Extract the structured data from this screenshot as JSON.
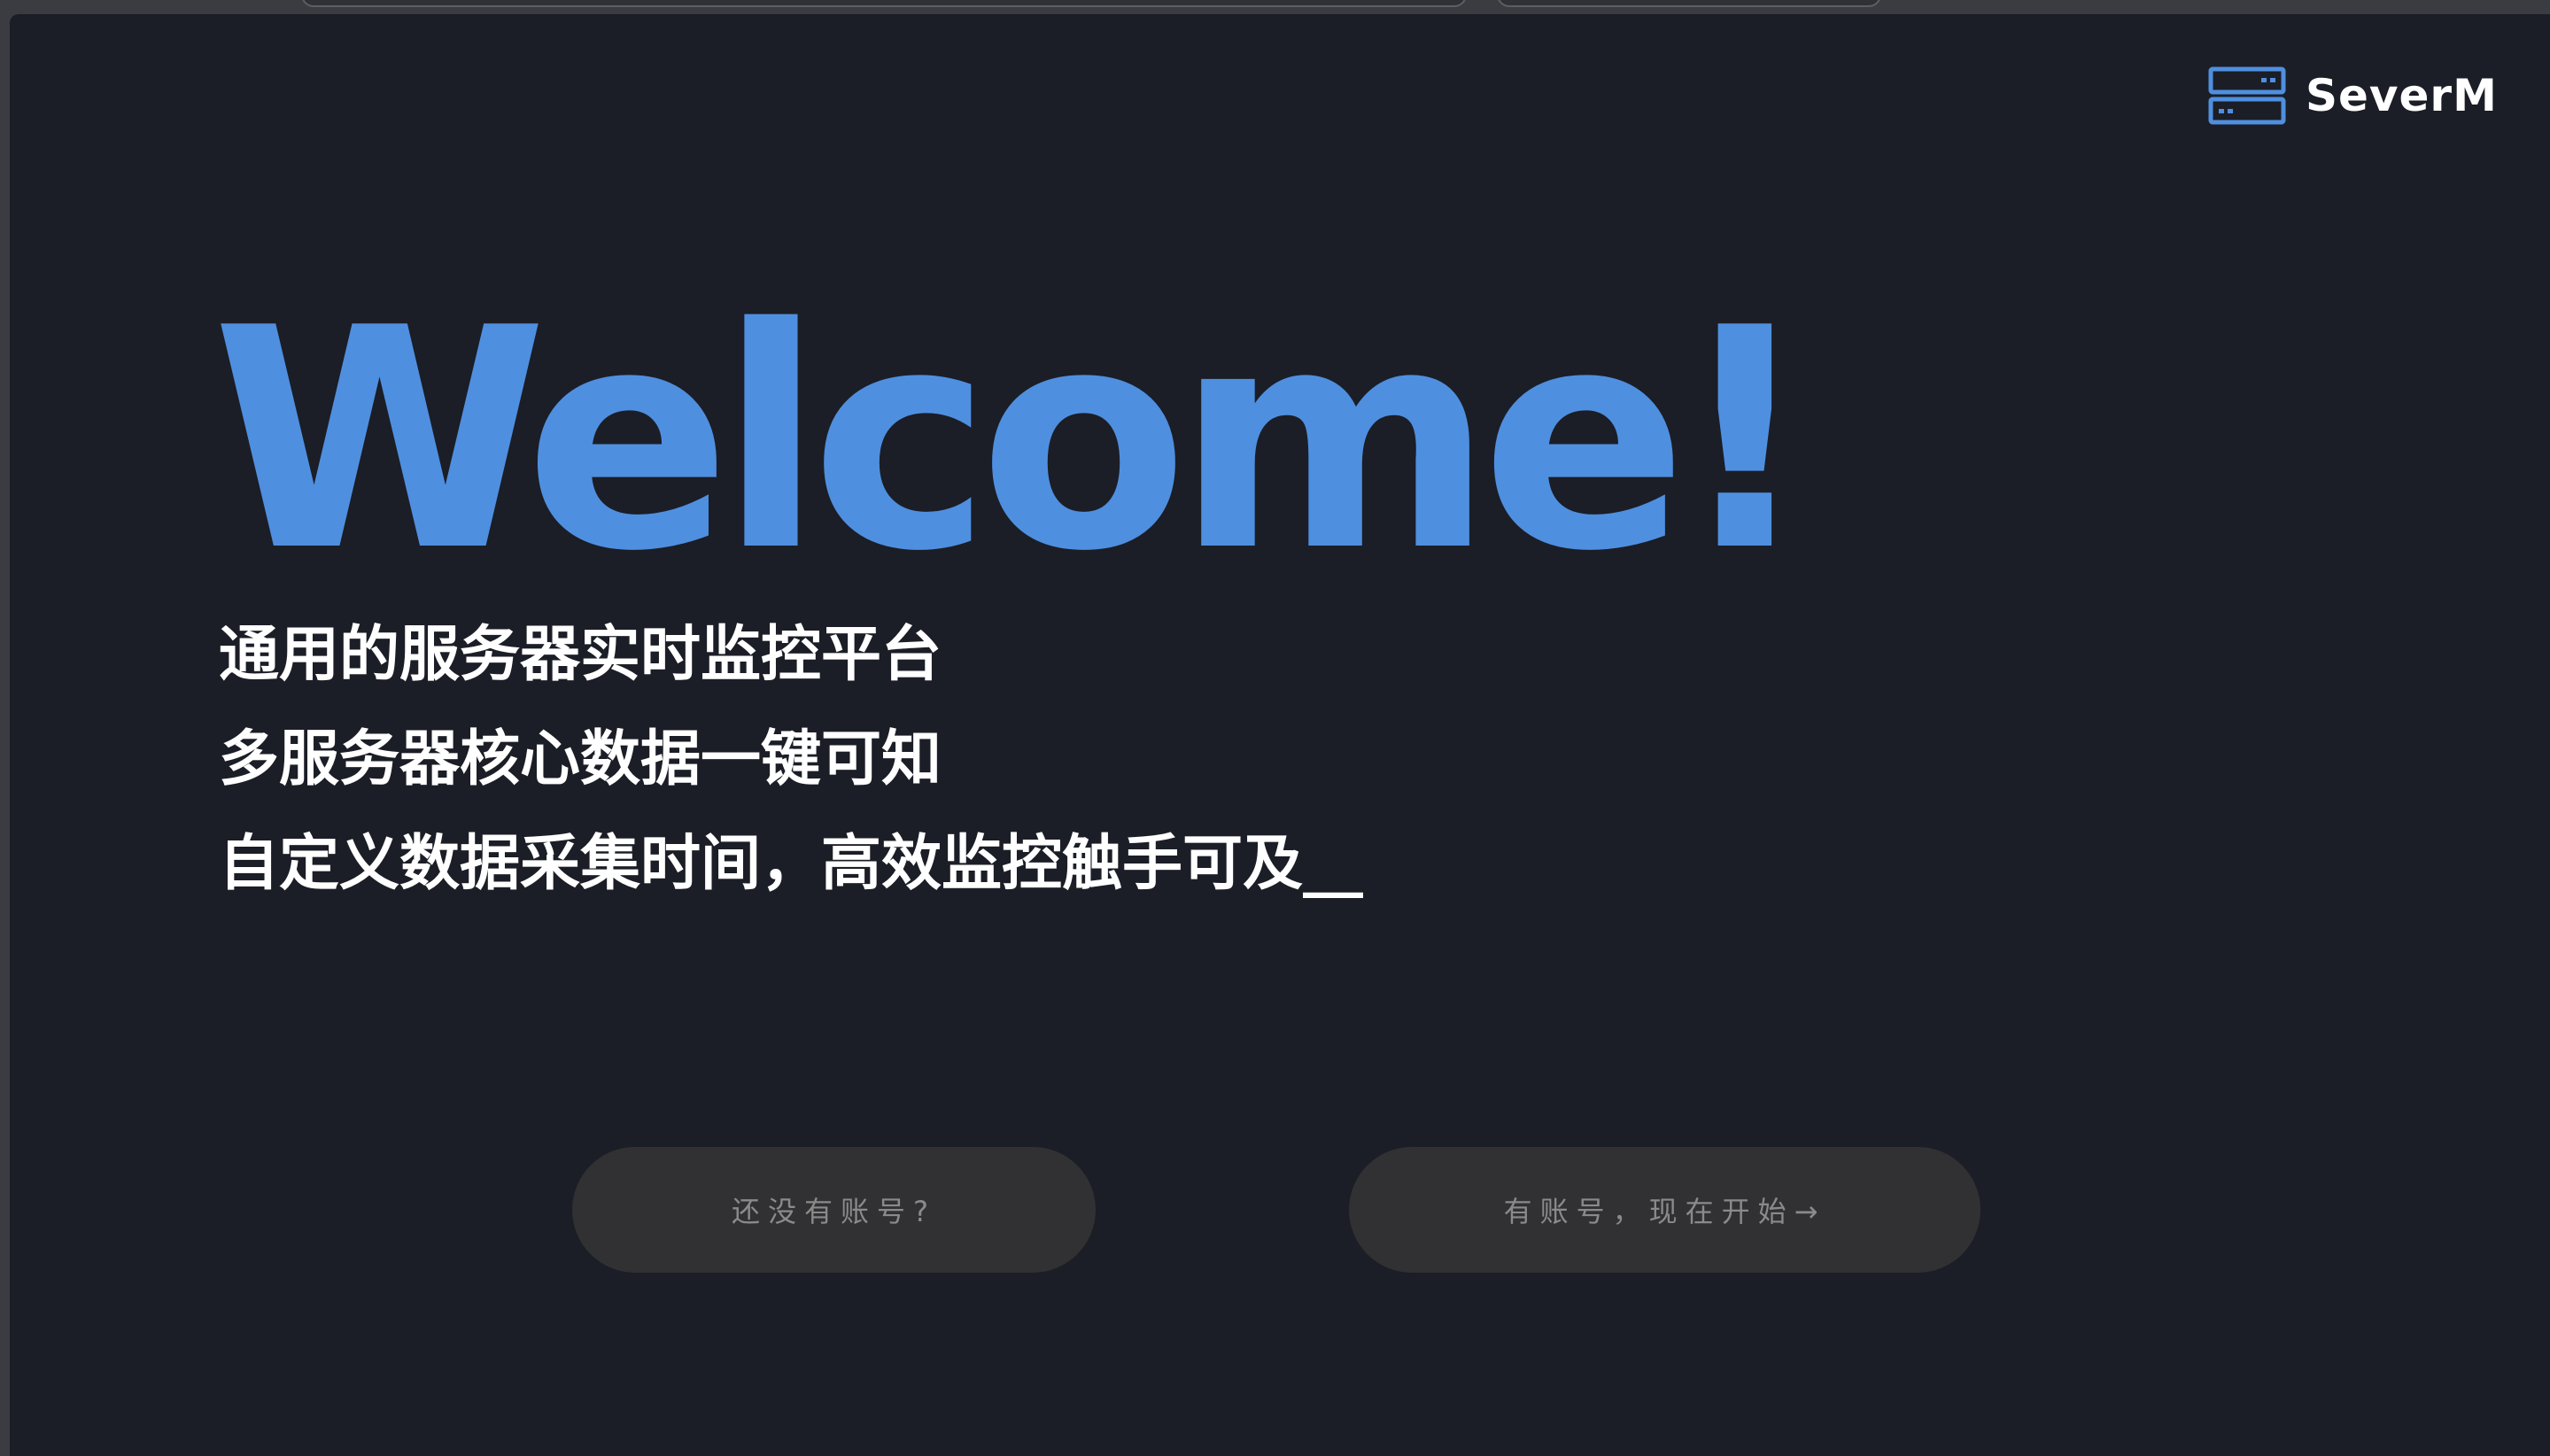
{
  "brand": {
    "name": "SeverM",
    "icon": "server-icon",
    "accent_color": "#4f8fe0"
  },
  "hero": {
    "title": "Welcome!",
    "taglines": [
      "通用的服务器实时监控平台",
      "多服务器核心数据一键可知",
      "自定义数据采集时间，高效监控触手可及__"
    ]
  },
  "actions": {
    "register_label": "还没有账号?",
    "login_label": "有账号，现在开始→"
  },
  "colors": {
    "background": "#1b1e26",
    "title": "#4f8fe0",
    "tagline": "#ffffff",
    "button_bg": "#313133",
    "button_text": "#8a8a8a"
  }
}
